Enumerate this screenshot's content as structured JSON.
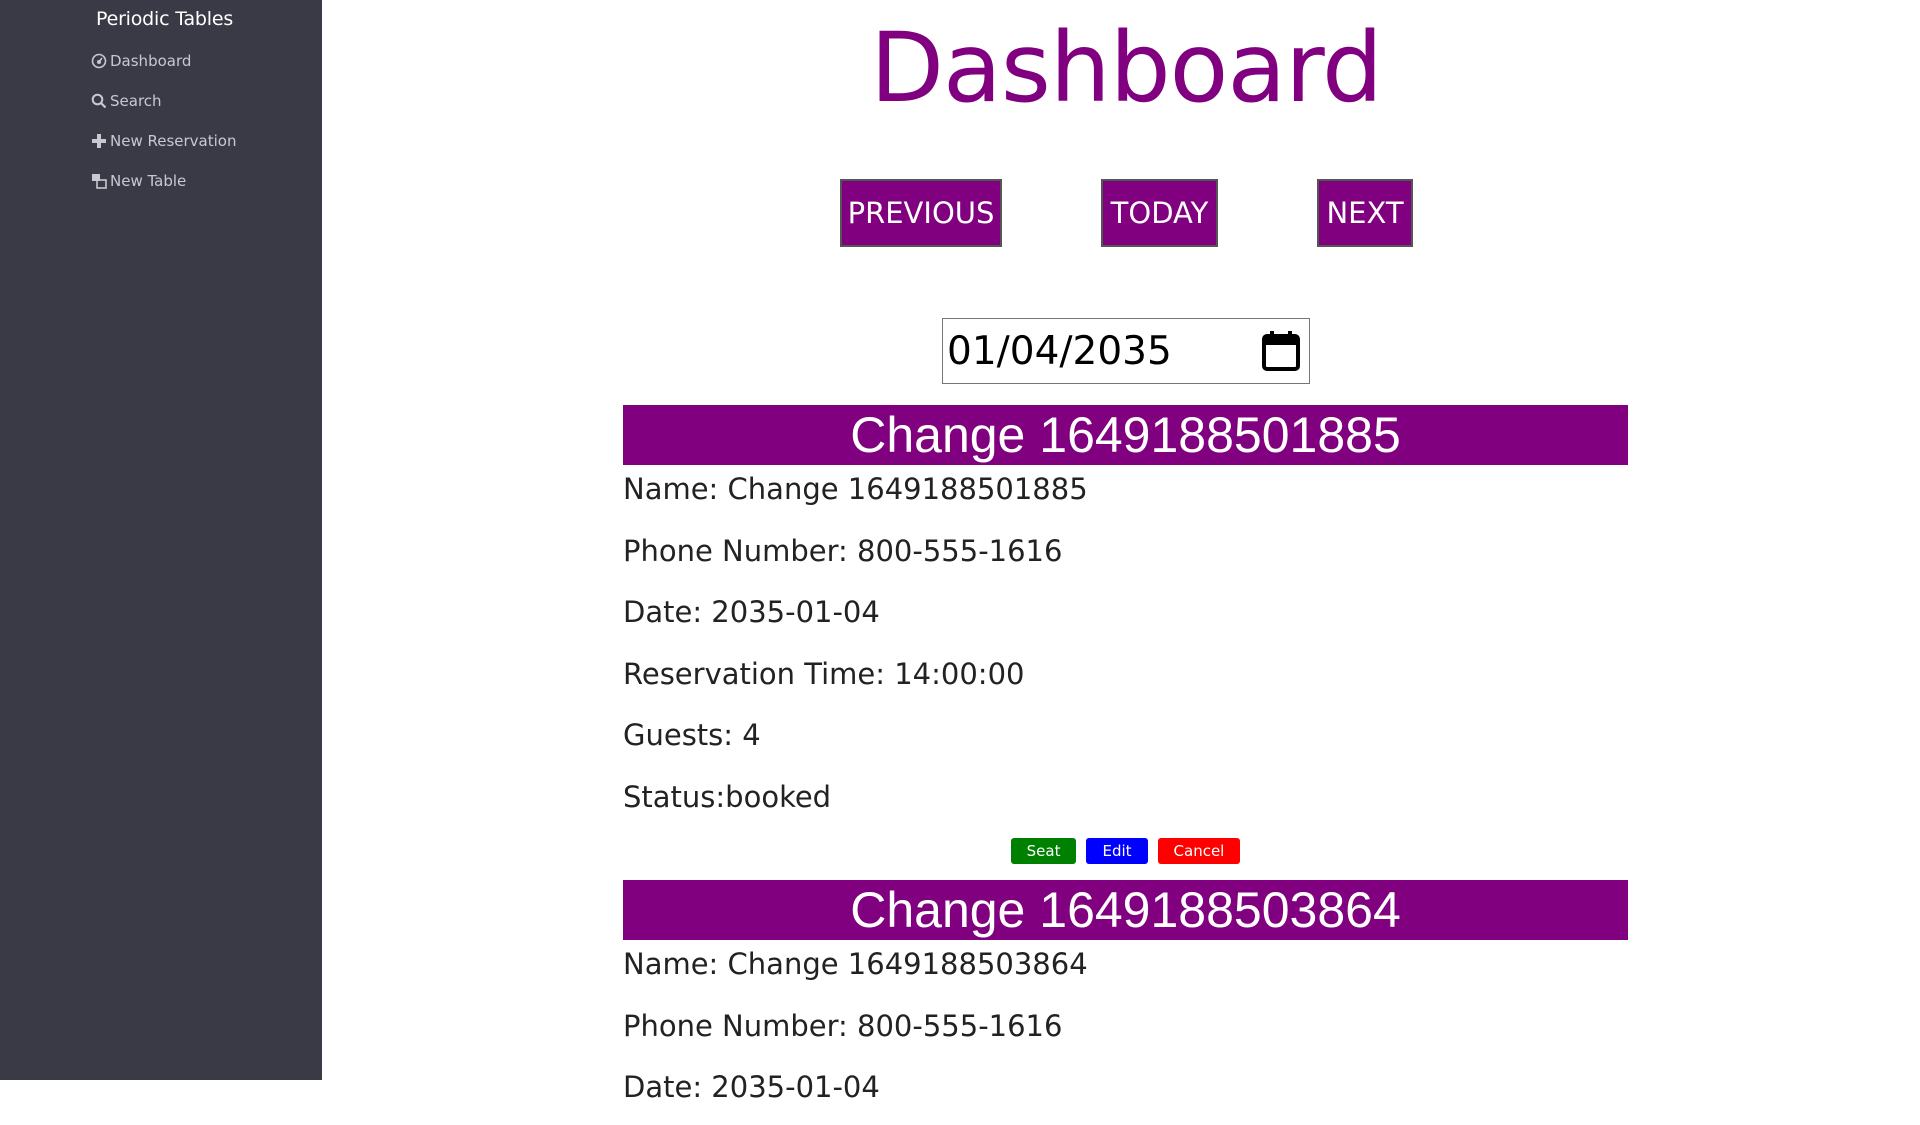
{
  "sidebar": {
    "brand": "Periodic Tables",
    "items": [
      {
        "label": "Dashboard",
        "icon": "dashboard-icon"
      },
      {
        "label": "Search",
        "icon": "search-icon"
      },
      {
        "label": "New Reservation",
        "icon": "plus-icon"
      },
      {
        "label": "New Table",
        "icon": "table-icon"
      }
    ]
  },
  "main": {
    "title": "Dashboard",
    "buttons": {
      "previous": "PREVIOUS",
      "today": "TODAY",
      "next": "NEXT"
    },
    "date_value": "01/04/2035"
  },
  "reservations": [
    {
      "header": "Change 1649188501885",
      "name": "Name: Change 1649188501885",
      "phone": "Phone Number: 800-555-1616",
      "date": "Date: 2035-01-04",
      "time": "Reservation Time: 14:00:00",
      "guests": "Guests: 4",
      "status": "Status:booked",
      "actions": {
        "seat": "Seat",
        "edit": "Edit",
        "cancel": "Cancel"
      }
    },
    {
      "header": "Change 1649188503864",
      "name": "Name: Change 1649188503864",
      "phone": "Phone Number: 800-555-1616",
      "date": "Date: 2035-01-04"
    }
  ],
  "colors": {
    "accent": "#800080",
    "sidebar_bg": "#3a3a47",
    "seat": "#008000",
    "edit": "#0000ff",
    "cancel": "#ff0000"
  }
}
